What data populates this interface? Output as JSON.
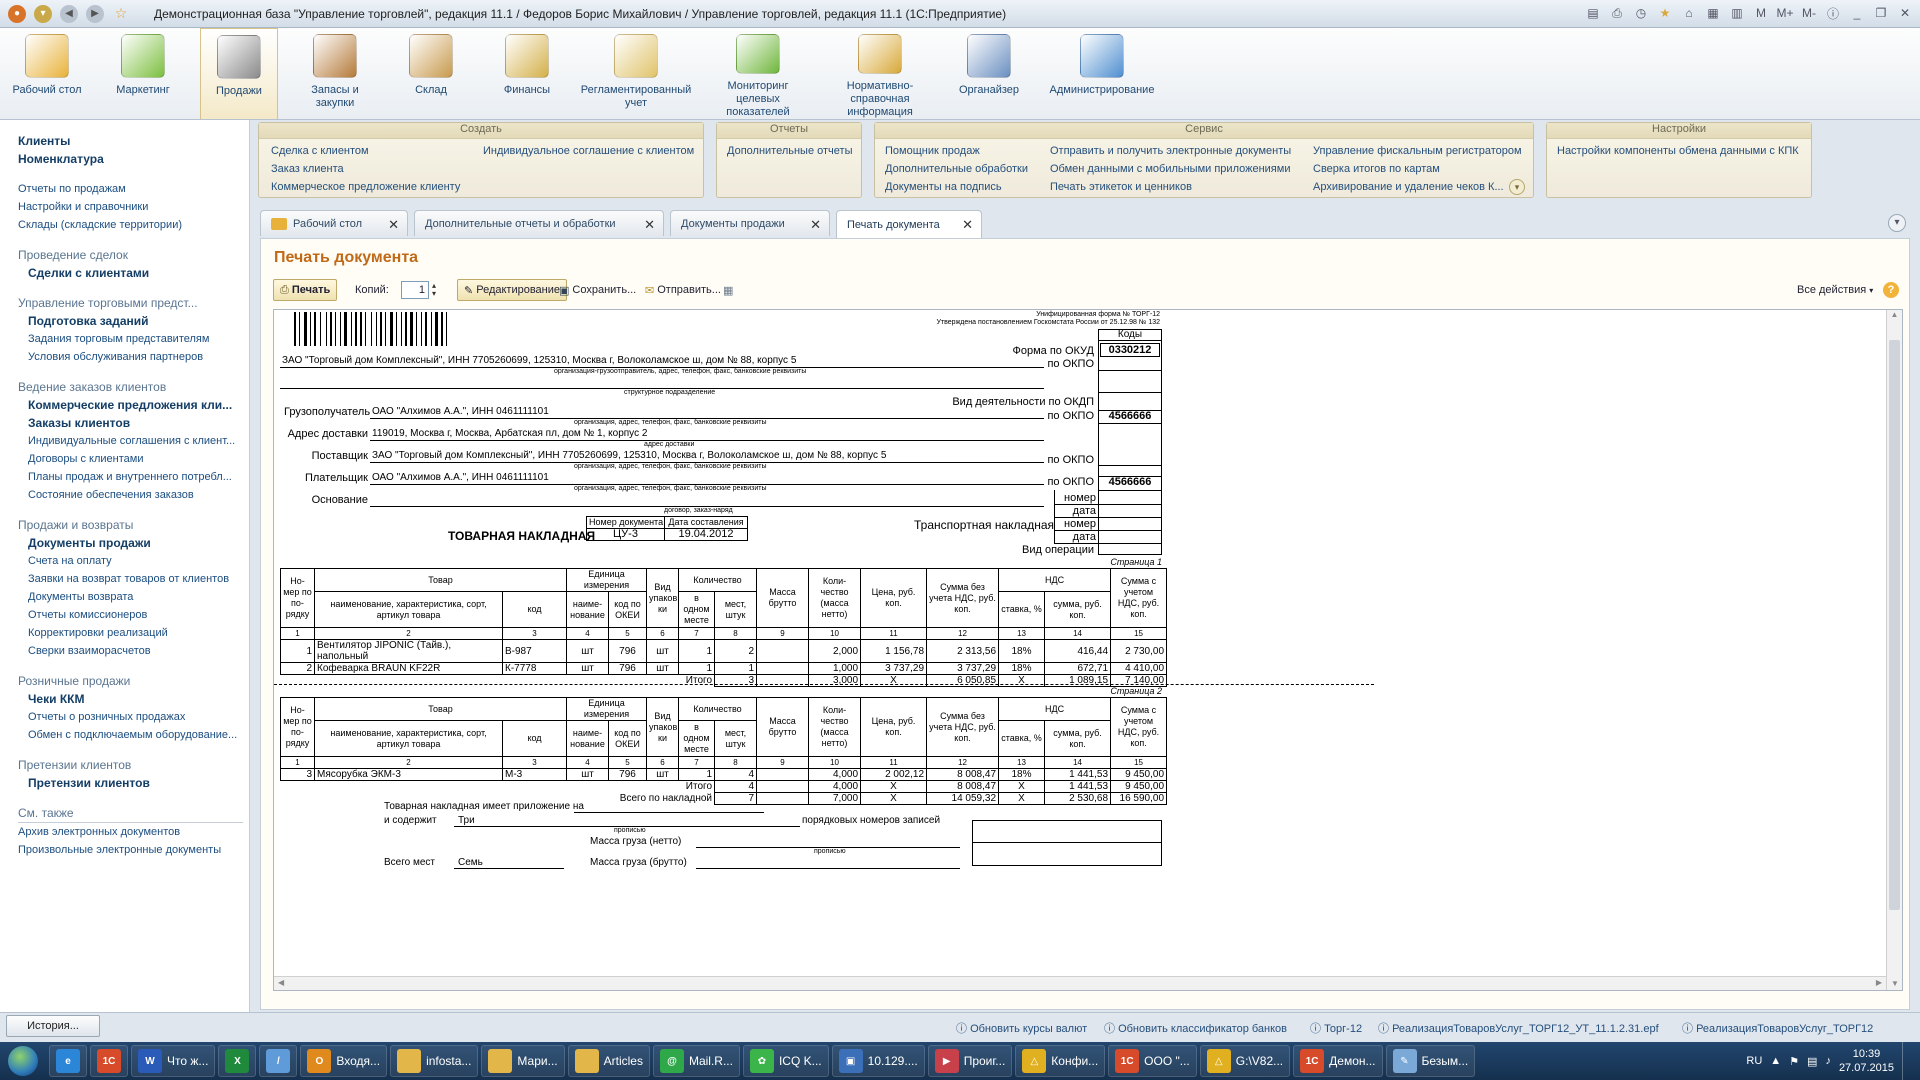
{
  "app": {
    "title": "Демонстрационная база \"Управление торговлей\", редакция 11.1 / Федоров Борис Михайлович / Управление торговлей, редакция 11.1  (1С:Предприятие)"
  },
  "sections": [
    {
      "label": "Рабочий стол",
      "icon": "desktop-icon",
      "color": "#e8b23a"
    },
    {
      "label": "Маркетинг",
      "icon": "pie-chart-icon",
      "color": "#7cbf3f"
    },
    {
      "label": "Продажи",
      "icon": "truck-icon",
      "color": "#8a8a8a"
    },
    {
      "label": "Запасы и закупки",
      "icon": "boxes-icon",
      "color": "#b57a3a"
    },
    {
      "label": "Склад",
      "icon": "crate-icon",
      "color": "#c89a4e"
    },
    {
      "label": "Финансы",
      "icon": "coins-icon",
      "color": "#d4b04a"
    },
    {
      "label": "Регламентированный учет",
      "icon": "document-pen-icon",
      "color": "#e0c36a"
    },
    {
      "label": "Мониторинг целевых показателей",
      "icon": "bar-chart-icon",
      "color": "#6fb63c"
    },
    {
      "label": "Нормативно-справочная информация",
      "icon": "binders-icon",
      "color": "#d8a93a"
    },
    {
      "label": "Органайзер",
      "icon": "clipboard-icon",
      "color": "#6a8fc0"
    },
    {
      "label": "Администрирование",
      "icon": "database-icon",
      "color": "#4f8fd0"
    }
  ],
  "leftnav": {
    "top_bold": [
      "Клиенты",
      "Номенклатура"
    ],
    "top_links": [
      "Отчеты по продажам",
      "Настройки и справочники",
      "Склады (складские территории)"
    ],
    "groups": [
      {
        "header": "Проведение сделок",
        "bold": [
          "Сделки с клиентами"
        ],
        "links": []
      },
      {
        "header": "Управление торговыми предст...",
        "bold": [
          "Подготовка заданий"
        ],
        "links": [
          "Задания торговым представителям",
          "Условия обслуживания партнеров"
        ]
      },
      {
        "header": "Ведение заказов клиентов",
        "bold": [
          "Коммерческие предложения кли...",
          "Заказы клиентов"
        ],
        "links": [
          "Индивидуальные соглашения с клиент...",
          "Договоры с клиентами",
          "Планы продаж и внутреннего потребл...",
          "Состояние обеспечения заказов"
        ]
      },
      {
        "header": "Продажи и возвраты",
        "bold": [
          "Документы продажи"
        ],
        "links": [
          "Счета на оплату",
          "Заявки на возврат товаров от клиентов",
          "Документы возврата",
          "Отчеты комиссионеров",
          "Корректировки реализаций",
          "Сверки взаиморасчетов"
        ]
      },
      {
        "header": "Розничные продажи",
        "bold": [
          "Чеки ККМ"
        ],
        "links": [
          "Отчеты о розничных продажах",
          "Обмен с подключаемым оборудование..."
        ]
      },
      {
        "header": "Претензии клиентов",
        "bold": [
          "Претензии клиентов"
        ],
        "links": []
      }
    ],
    "see_also": "См. также",
    "see_links": [
      "Архив электронных документов",
      "Произвольные электронные документы"
    ]
  },
  "navpanel": {
    "create": {
      "title": "Создать",
      "links": [
        "Сделка с клиентом",
        "Заказ клиента",
        "Коммерческое предложение клиенту",
        "Индивидуальное соглашение с клиентом"
      ]
    },
    "reports": {
      "title": "Отчеты",
      "links": [
        "Дополнительные отчеты"
      ]
    },
    "service": {
      "title": "Сервис",
      "links": [
        "Помощник продаж",
        "Дополнительные обработки",
        "Документы на подпись",
        "Отправить и получить электронные документы",
        "Обмен данными с мобильными приложениями",
        "Печать этикеток и ценников",
        "Управление фискальным регистратором",
        "Сверка итогов по картам",
        "Архивирование и удаление чеков К..."
      ]
    },
    "settings": {
      "title": "Настройки",
      "links": [
        "Настройки компоненты обмена данными с КПК"
      ]
    }
  },
  "tabs": [
    {
      "label": "Рабочий стол"
    },
    {
      "label": "Дополнительные отчеты и обработки"
    },
    {
      "label": "Документы продажи"
    },
    {
      "label": "Печать документа"
    }
  ],
  "form": {
    "title": "Печать документа",
    "print_btn": "Печать",
    "copies_label": "Копий:",
    "copies_value": "1",
    "edit_btn": "Редактирование",
    "save_btn": "Сохранить...",
    "send_btn": "Отправить...",
    "all_actions": "Все действия"
  },
  "doc": {
    "form_header1": "Унифицированная форма № ТОРГ-12",
    "form_header2": "Утверждена постановлением Госкомстата России от 25.12.98 № 132",
    "codes": "Коды",
    "okud_label": "Форма по ОКУД",
    "okud_value": "0330212",
    "okpo_label": "по ОКПО",
    "okdp_label": "Вид деятельности по ОКДП",
    "okpo_consignee": "4566666",
    "okpo_payer": "4566666",
    "shipper": "ЗАО \"Торговый дом Комплексный\", ИНН 7705260699, 125310, Москва г, Волоколамское ш, дом № 88, корпус 5",
    "cap_org": "организация-грузоотправитель, адрес, телефон, факс, банковские реквизиты",
    "cap_struct": "структурное подразделение",
    "consignee_label": "Грузополучатель",
    "consignee": "ОАО \"Алхимов А.А.\", ИНН 0461111101",
    "cap_org2": "организация, адрес, телефон, факс, банковские реквизиты",
    "delivery_label": "Адрес доставки",
    "delivery": "119019, Москва г, Москва, Арбатская пл, дом № 1, корпус 2",
    "cap_addr": "адрес доставки",
    "supplier_label": "Поставщик",
    "supplier": "ЗАО \"Торговый дом Комплексный\", ИНН 7705260699, 125310, Москва г, Волоколамское ш, дом № 88, корпус 5",
    "payer_label": "Плательщик",
    "payer": "ОАО \"Алхимов А.А.\", ИНН 0461111101",
    "basis_label": "Основание",
    "cap_contract": "договор, заказ-наряд",
    "nomer": "номер",
    "data": "дата",
    "transport": "Транспортная накладная",
    "op_type": "Вид операции",
    "doc_no_h": "Номер документа",
    "doc_date_h": "Дата составления",
    "doc_no": "ЦУ-3",
    "doc_date": "19.04.2012",
    "doc_name": "ТОВАРНАЯ НАКЛАДНАЯ",
    "page1": "Страница 1",
    "page2": "Страница 2",
    "h_num": "Но-мер по по-рядку",
    "h_tovar": "Товар",
    "h_tovar_name": "наименование, характеристика, сорт, артикул товара",
    "h_code": "код",
    "h_unit": "Единица измерения",
    "h_unit_name": "наиме-нование",
    "h_okei": "код по ОКЕИ",
    "h_pack": "Вид упаков ки",
    "h_qty": "Количество",
    "h_in_one": "в одном месте",
    "h_places": "мест, штук",
    "h_gross": "Масса брутто",
    "h_qty_net": "Коли-чество (масса нетто)",
    "h_price": "Цена, руб. коп.",
    "h_sum_novat": "Сумма без учета НДС, руб. коп.",
    "h_vat": "НДС",
    "h_vat_rate": "ставка, %",
    "h_vat_sum": "сумма, руб. коп.",
    "h_sum_vat": "Сумма с учетом НДС, руб. коп.",
    "col_nums": [
      "1",
      "2",
      "3",
      "4",
      "5",
      "6",
      "7",
      "8",
      "9",
      "10",
      "11",
      "12",
      "13",
      "14",
      "15"
    ],
    "rows1": [
      {
        "n": "1",
        "name1": "Вентилятор JIPONIC (Тайв.),",
        "name2": "напольный",
        "code": "В-987",
        "unit": "шт",
        "okei": "796",
        "pack": "шт",
        "in_one": "1",
        "places": "2",
        "gross": "",
        "qty": "2,000",
        "price": "1 156,78",
        "sum": "2 313,56",
        "rate": "18%",
        "vat": "416,44",
        "total": "2 730,00"
      },
      {
        "n": "2",
        "name1": "Кофеварка BRAUN KF22R",
        "name2": "",
        "code": "К-7778",
        "unit": "шт",
        "okei": "796",
        "pack": "шт",
        "in_one": "1",
        "places": "1",
        "gross": "",
        "qty": "1,000",
        "price": "3 737,29",
        "sum": "3 737,29",
        "rate": "18%",
        "vat": "672,71",
        "total": "4 410,00"
      }
    ],
    "itogo": "Итого",
    "itogo1": {
      "places": "3",
      "qty": "3,000",
      "price": "Х",
      "sum": "6 050,85",
      "rate": "Х",
      "vat": "1 089,15",
      "total": "7 140,00"
    },
    "rows2": [
      {
        "n": "3",
        "name1": "Мясорубка ЭКМ-3",
        "code": "М-3",
        "unit": "шт",
        "okei": "796",
        "pack": "шт",
        "in_one": "1",
        "places": "4",
        "gross": "",
        "qty": "4,000",
        "price": "2 002,12",
        "sum": "8 008,47",
        "rate": "18%",
        "vat": "1 441,53",
        "total": "9 450,00"
      }
    ],
    "itogo2": {
      "places": "4",
      "qty": "4,000",
      "price": "Х",
      "sum": "8 008,47",
      "rate": "Х",
      "vat": "1 441,53",
      "total": "9 450,00"
    },
    "total_label": "Всего по накладной",
    "total_all": {
      "places": "7",
      "qty": "7,000",
      "price": "Х",
      "sum": "14 059,32",
      "rate": "Х",
      "vat": "2 530,68",
      "total": "16 590,00"
    },
    "attach_text1": "Товарная накладная имеет приложение на",
    "attach_text2": "и содержит",
    "attach_value": "Три",
    "attach_tail": "порядковых номеров записей",
    "propis": "прописью",
    "mass_net": "Масса груза (нетто)",
    "mass_gross": "Масса груза (брутто)",
    "total_places_label": "Всего мест",
    "total_places_value": "Семь"
  },
  "statusbar": {
    "history": "История...",
    "links": [
      "Обновить курсы валют",
      "Обновить классификатор банков",
      "Торг-12",
      "РеализацияТоваровУслуг_ТОРГ12_УТ_11.1.2.31.epf",
      "РеализацияТоваровУслуг_ТОРГ12"
    ]
  },
  "taskbar": {
    "items": [
      {
        "label": "",
        "icon": "ie-icon",
        "color": "#2c86d8",
        "glyph": "e"
      },
      {
        "label": "",
        "icon": "1c-icon",
        "color": "#d84b2a",
        "glyph": "1С"
      },
      {
        "label": "Что ж...",
        "icon": "word-icon",
        "color": "#2b5bb8",
        "glyph": "W"
      },
      {
        "label": "",
        "icon": "excel-icon",
        "color": "#1f8a3c",
        "glyph": "X"
      },
      {
        "label": "",
        "icon": "pen-icon",
        "color": "#5f9bd8",
        "glyph": "/"
      },
      {
        "label": "Входя...",
        "icon": "outlook-icon",
        "color": "#e08a1e",
        "glyph": "O"
      },
      {
        "label": "infosta...",
        "icon": "folder-icon",
        "color": "#e3b64a",
        "glyph": ""
      },
      {
        "label": "Мари...",
        "icon": "folder-icon",
        "color": "#e3b64a",
        "glyph": ""
      },
      {
        "label": "Articles",
        "icon": "folder-icon",
        "color": "#e3b64a",
        "glyph": ""
      },
      {
        "label": "Mail.R...",
        "icon": "mail-icon",
        "color": "#2fa84a",
        "glyph": "@"
      },
      {
        "label": "ICQ K...",
        "icon": "icq-icon",
        "color": "#3bb54a",
        "glyph": "✿"
      },
      {
        "label": "10.129....",
        "icon": "remote-icon",
        "color": "#3b6fb8",
        "glyph": "▣"
      },
      {
        "label": "Проиг...",
        "icon": "player-icon",
        "color": "#c8404a",
        "glyph": "▶"
      },
      {
        "label": "Конфи...",
        "icon": "config-icon",
        "color": "#e0b020",
        "glyph": "△"
      },
      {
        "label": "ООО \"...",
        "icon": "1c-icon",
        "color": "#d84b2a",
        "glyph": "1С"
      },
      {
        "label": "G:\\V82...",
        "icon": "config-icon",
        "color": "#e0b020",
        "glyph": "△"
      },
      {
        "label": "Демон...",
        "icon": "1c-icon",
        "color": "#d84b2a",
        "glyph": "1С"
      },
      {
        "label": "Безым...",
        "icon": "paint-icon",
        "color": "#7aa9d8",
        "glyph": "✎"
      }
    ],
    "lang": "RU",
    "time": "10:39",
    "date": "27.07.2015"
  }
}
